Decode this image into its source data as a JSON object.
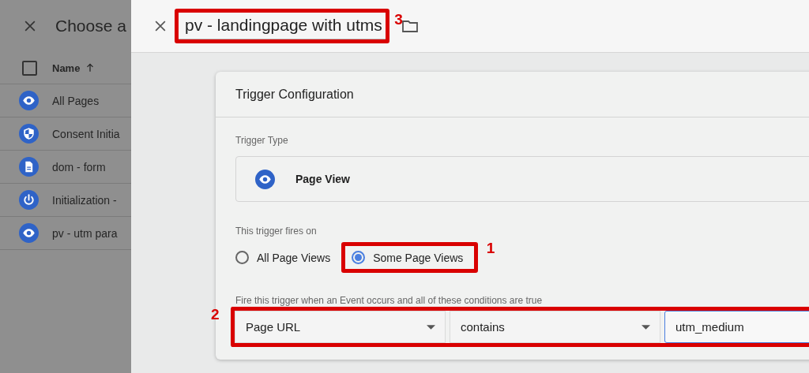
{
  "background_panel": {
    "title": "Choose a",
    "select_all": {
      "checked": false
    },
    "column_header": "Name",
    "sorted": true,
    "rows": [
      {
        "name": "All Pages",
        "kind": "eye"
      },
      {
        "name": "Consent Initia",
        "kind": "shield"
      },
      {
        "name": "dom - form",
        "kind": "document"
      },
      {
        "name": "Initialization -",
        "kind": "power"
      },
      {
        "name": "pv - utm para",
        "kind": "eye"
      }
    ]
  },
  "editor": {
    "title": "pv - landingpage with utms",
    "title_mark": {
      "number": "3"
    },
    "card": {
      "title": "Trigger Configuration",
      "trigger_type_label": "Trigger Type",
      "trigger_type": {
        "name": "Page View",
        "kind": "eye"
      },
      "fires_on_label": "This trigger fires on",
      "fires_on": [
        {
          "label": "All Page Views",
          "selected": false
        },
        {
          "label": "Some Page Views",
          "selected": true,
          "mark": {
            "number": "1"
          }
        }
      ],
      "conditions_label": "Fire this trigger when an Event occurs and all of these conditions are true",
      "condition": {
        "variable": "Page URL",
        "operator": "contains",
        "value": "utm_medium",
        "mark": {
          "number": "2"
        }
      }
    }
  }
}
